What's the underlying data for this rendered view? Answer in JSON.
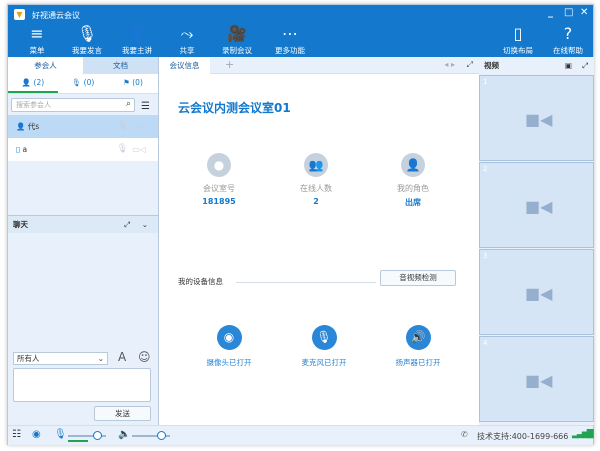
{
  "window": {
    "title": "好视通云会议",
    "minimize": "_",
    "maximize": "□",
    "close": "✕"
  },
  "toolbar": [
    {
      "label": "菜单",
      "icon": "≡"
    },
    {
      "label": "我要发言",
      "icon": "🎙"
    },
    {
      "label": "我要主讲",
      "icon": "👤"
    },
    {
      "label": "共享",
      "icon": "⤳"
    },
    {
      "label": "录制会议",
      "icon": "🎥"
    },
    {
      "label": "更多功能",
      "icon": "⋯"
    }
  ],
  "toolbar_right": [
    {
      "label": "切换布局",
      "icon": "▯"
    },
    {
      "label": "在线帮助",
      "icon": "?"
    }
  ],
  "left": {
    "tabs": [
      "参会人",
      "文档"
    ],
    "counts": [
      "(2)",
      "(0)",
      "(0)"
    ],
    "search_placeholder": "搜索参会人",
    "participants": [
      {
        "name": "代s"
      },
      {
        "name": "a"
      }
    ],
    "chat_title": "聊天",
    "recipient": "所有人",
    "send": "发送"
  },
  "main": {
    "tab": "会议信息",
    "add": "+",
    "room_title": "云会议内测会议室01",
    "info": [
      {
        "label": "会议室号",
        "value": "181895"
      },
      {
        "label": "在线人数",
        "value": "2"
      },
      {
        "label": "我的角色",
        "value": "出席"
      }
    ],
    "device_title": "我的设备信息",
    "check_button": "音视频检测",
    "devices": [
      {
        "label": "摄像头已打开"
      },
      {
        "label": "麦克风已打开"
      },
      {
        "label": "扬声器已打开"
      }
    ]
  },
  "video": {
    "title": "视频",
    "cells": [
      "1",
      "2",
      "3",
      "4"
    ]
  },
  "status": {
    "support": "技术支持:400-1699-666",
    "mic_level": 0.75,
    "speaker_level": 0.75
  }
}
